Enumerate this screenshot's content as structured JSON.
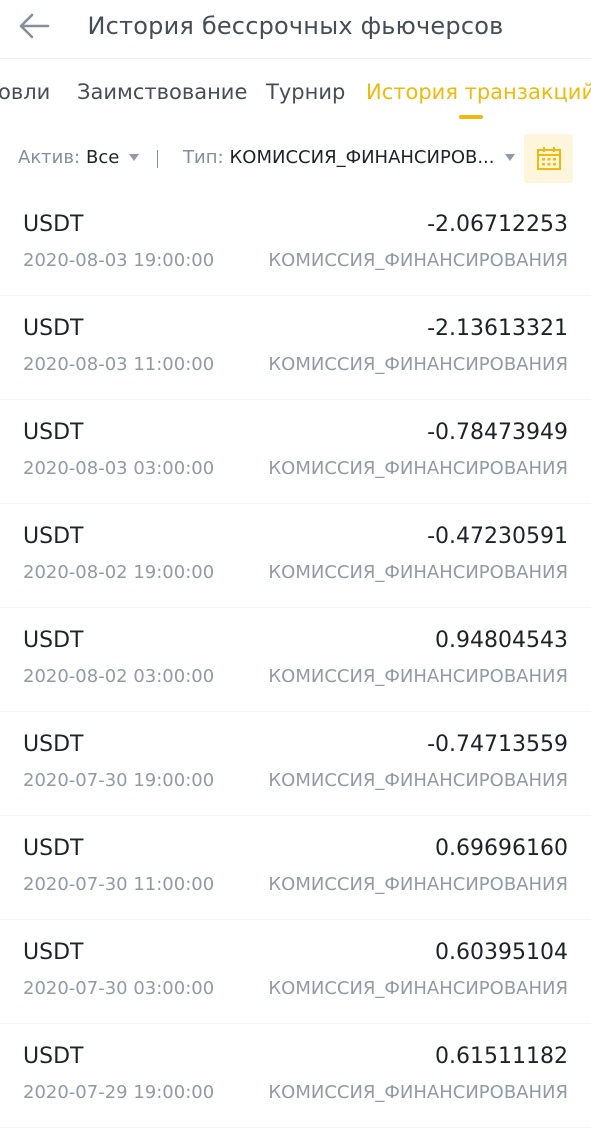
{
  "header": {
    "title": "История бессрочных фьючерсов",
    "back_icon": "arrow-left-icon"
  },
  "tabs": [
    {
      "label": "овли",
      "active": false
    },
    {
      "label": "Заимствование",
      "active": false
    },
    {
      "label": "Турнир",
      "active": false
    },
    {
      "label": "История транзакций",
      "active": true
    }
  ],
  "filters": {
    "asset_label": "Актив:",
    "asset_value": "Все",
    "type_label": "Тип:",
    "type_value": "КОМИССИЯ_ФИНАНСИРОВ...",
    "calendar_icon": "calendar-icon"
  },
  "colors": {
    "accent": "#f0b90b",
    "accent_bg": "#fdf5dc",
    "text_primary": "#1e2329",
    "text_secondary": "#929aa5"
  },
  "transactions": [
    {
      "asset": "USDT",
      "amount": "-2.06712253",
      "time": "2020-08-03 19:00:00",
      "type": "КОМИССИЯ_ФИНАНСИРОВАНИЯ"
    },
    {
      "asset": "USDT",
      "amount": "-2.13613321",
      "time": "2020-08-03 11:00:00",
      "type": "КОМИССИЯ_ФИНАНСИРОВАНИЯ"
    },
    {
      "asset": "USDT",
      "amount": "-0.78473949",
      "time": "2020-08-03 03:00:00",
      "type": "КОМИССИЯ_ФИНАНСИРОВАНИЯ"
    },
    {
      "asset": "USDT",
      "amount": "-0.47230591",
      "time": "2020-08-02 19:00:00",
      "type": "КОМИССИЯ_ФИНАНСИРОВАНИЯ"
    },
    {
      "asset": "USDT",
      "amount": "0.94804543",
      "time": "2020-08-02 03:00:00",
      "type": "КОМИССИЯ_ФИНАНСИРОВАНИЯ"
    },
    {
      "asset": "USDT",
      "amount": "-0.74713559",
      "time": "2020-07-30 19:00:00",
      "type": "КОМИССИЯ_ФИНАНСИРОВАНИЯ"
    },
    {
      "asset": "USDT",
      "amount": "0.69696160",
      "time": "2020-07-30 11:00:00",
      "type": "КОМИССИЯ_ФИНАНСИРОВАНИЯ"
    },
    {
      "asset": "USDT",
      "amount": "0.60395104",
      "time": "2020-07-30 03:00:00",
      "type": "КОМИССИЯ_ФИНАНСИРОВАНИЯ"
    },
    {
      "asset": "USDT",
      "amount": "0.61511182",
      "time": "2020-07-29 19:00:00",
      "type": "КОМИССИЯ_ФИНАНСИРОВАНИЯ"
    }
  ]
}
